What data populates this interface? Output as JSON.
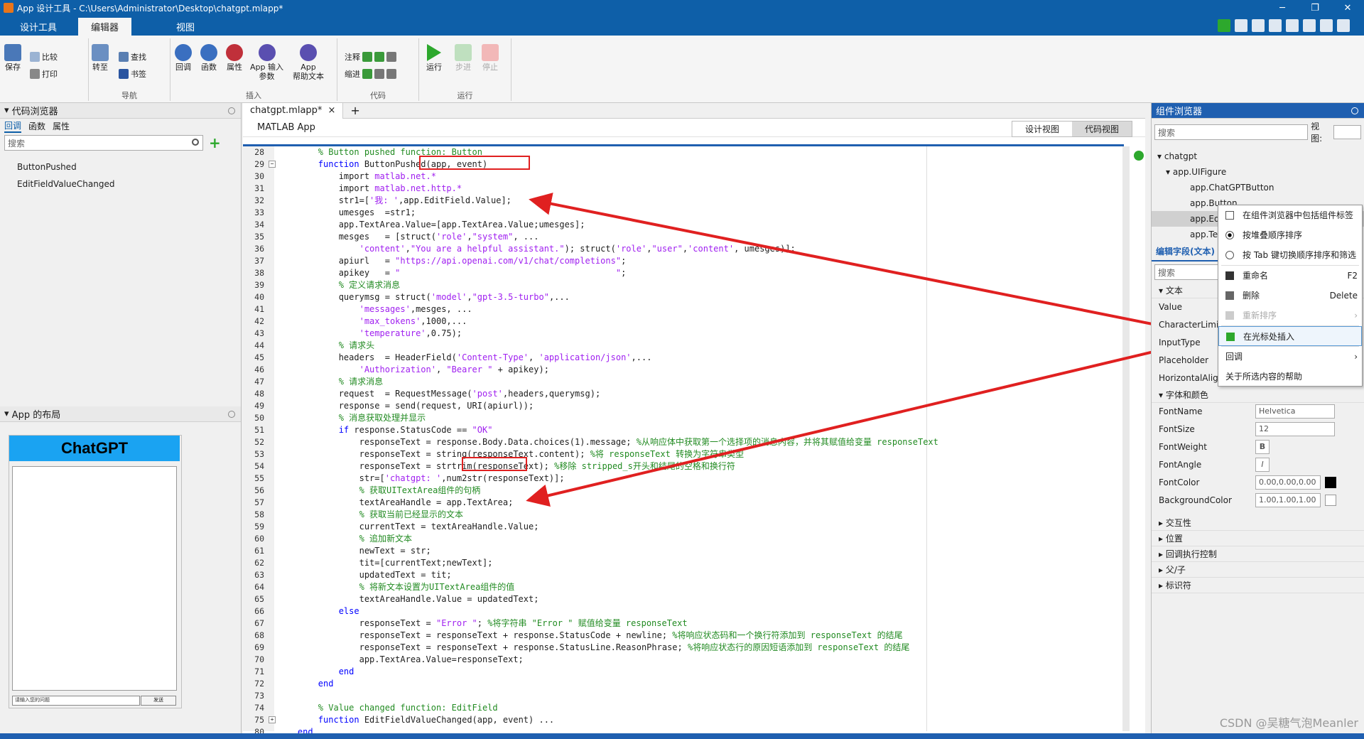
{
  "window": {
    "title": "App 设计工具 - C:\\Users\\Administrator\\Desktop\\chatgpt.mlapp*",
    "controls": [
      "─",
      "❐",
      "✕"
    ]
  },
  "ribbon_tabs": [
    "设计工具",
    "编辑器",
    "视图"
  ],
  "ribbon": {
    "file": {
      "save": "保存",
      "compare": "比较",
      "print": "打印"
    },
    "nav": {
      "goto": "转至",
      "find": "查找",
      "bookmark": "书签",
      "label": "导航"
    },
    "insert": {
      "callback": "回调",
      "function": "函数",
      "property": "属性",
      "app_input": "App 输入\n参数",
      "app_help": "App\n帮助文本",
      "label": "插入"
    },
    "code": {
      "comment": "注释",
      "indent": "缩进",
      "label": "代码"
    },
    "run": {
      "run": "运行",
      "step": "步进",
      "stop": "停止",
      "label": "运行"
    }
  },
  "code_browser": {
    "title": "代码浏览器",
    "tabs": [
      "回调",
      "函数",
      "属性"
    ],
    "search_placeholder": "搜索",
    "items": [
      "ButtonPushed",
      "EditFieldValueChanged"
    ]
  },
  "app_layout": {
    "title": "App 的布局",
    "chat_button": "ChatGPT",
    "input_placeholder": "请输入您的问题",
    "send": "发送"
  },
  "editor": {
    "file_tab": "chatgpt.mlapp*",
    "new_tab": "+",
    "header": "MATLAB App",
    "view_design": "设计视图",
    "view_code": "代码视图",
    "lines": [
      {
        "n": "28",
        "segs": [
          [
            "cm",
            "        % Button pushed function: Button"
          ]
        ]
      },
      {
        "n": "29",
        "fold": "−",
        "segs": [
          [
            "kw",
            "        function "
          ],
          [
            "",
            "ButtonPushed(app, event)"
          ]
        ]
      },
      {
        "n": "30",
        "segs": [
          [
            "",
            "            import "
          ],
          [
            "str",
            "matlab.net.*"
          ]
        ]
      },
      {
        "n": "31",
        "segs": [
          [
            "",
            "            import "
          ],
          [
            "str",
            "matlab.net.http.*"
          ]
        ]
      },
      {
        "n": "32",
        "segs": [
          [
            "",
            "            str1=["
          ],
          [
            "str",
            "'我: '"
          ],
          [
            "",
            ",app.EditField.Value];"
          ]
        ]
      },
      {
        "n": "33",
        "segs": [
          [
            "",
            "            umesges  =str1;"
          ]
        ]
      },
      {
        "n": "34",
        "segs": [
          [
            "",
            "            app.TextArea.Value=[app.TextArea.Value;umesges];"
          ]
        ]
      },
      {
        "n": "35",
        "segs": [
          [
            "",
            "            mesges   = [struct("
          ],
          [
            "str",
            "'role'"
          ],
          [
            "",
            ","
          ],
          [
            "str",
            "\"system\""
          ],
          [
            "",
            ", ..."
          ]
        ]
      },
      {
        "n": "36",
        "segs": [
          [
            "",
            "                "
          ],
          [
            "str",
            "'content'"
          ],
          [
            "",
            ","
          ],
          [
            "str",
            "\"You are a helpful assistant.\""
          ],
          [
            "",
            "); struct("
          ],
          [
            "str",
            "'role'"
          ],
          [
            "",
            ","
          ],
          [
            "str",
            "\"user\""
          ],
          [
            "",
            ","
          ],
          [
            "str",
            "'content'"
          ],
          [
            "",
            ", umesges)];"
          ]
        ]
      },
      {
        "n": "37",
        "segs": [
          [
            "",
            "            apiurl   = "
          ],
          [
            "str",
            "\"https://api.openai.com/v1/chat/completions\""
          ],
          [
            "",
            ";"
          ]
        ]
      },
      {
        "n": "38",
        "segs": [
          [
            "",
            "            apikey   = "
          ],
          [
            "str",
            "\"                                          \""
          ],
          [
            "",
            ";"
          ]
        ]
      },
      {
        "n": "39",
        "segs": [
          [
            "cm",
            "            % 定义请求消息"
          ]
        ]
      },
      {
        "n": "40",
        "segs": [
          [
            "",
            "            querymsg = struct("
          ],
          [
            "str",
            "'model'"
          ],
          [
            "",
            ","
          ],
          [
            "str",
            "\"gpt-3.5-turbo\""
          ],
          [
            "",
            ",..."
          ]
        ]
      },
      {
        "n": "41",
        "segs": [
          [
            "",
            "                "
          ],
          [
            "str",
            "'messages'"
          ],
          [
            "",
            ",mesges, ..."
          ]
        ]
      },
      {
        "n": "42",
        "segs": [
          [
            "",
            "                "
          ],
          [
            "str",
            "'max_tokens'"
          ],
          [
            "",
            ",1000,..."
          ]
        ]
      },
      {
        "n": "43",
        "segs": [
          [
            "",
            "                "
          ],
          [
            "str",
            "'temperature'"
          ],
          [
            "",
            ",0.75);"
          ]
        ]
      },
      {
        "n": "44",
        "segs": [
          [
            "cm",
            "            % 请求头"
          ]
        ]
      },
      {
        "n": "45",
        "segs": [
          [
            "",
            "            headers  = HeaderField("
          ],
          [
            "str",
            "'Content-Type'"
          ],
          [
            "",
            ", "
          ],
          [
            "str",
            "'application/json'"
          ],
          [
            "",
            ",..."
          ]
        ]
      },
      {
        "n": "46",
        "segs": [
          [
            "",
            "                "
          ],
          [
            "str",
            "'Authorization'"
          ],
          [
            "",
            ", "
          ],
          [
            "str",
            "\"Bearer \""
          ],
          [
            "",
            " + apikey);"
          ]
        ]
      },
      {
        "n": "47",
        "segs": [
          [
            "cm",
            "            % 请求消息"
          ]
        ]
      },
      {
        "n": "48",
        "segs": [
          [
            "",
            "            request  = RequestMessage("
          ],
          [
            "str",
            "'post'"
          ],
          [
            "",
            ",headers,querymsg);"
          ]
        ]
      },
      {
        "n": "49",
        "segs": [
          [
            "",
            "            response = send(request, URI(apiurl));"
          ]
        ]
      },
      {
        "n": "50",
        "segs": [
          [
            "cm",
            "            % 消息获取处理并显示"
          ]
        ]
      },
      {
        "n": "51",
        "segs": [
          [
            "kw",
            "            if "
          ],
          [
            "",
            "response.StatusCode == "
          ],
          [
            "str",
            "\"OK\""
          ]
        ]
      },
      {
        "n": "52",
        "segs": [
          [
            "",
            "                responseText = response.Body.Data.choices(1).message; "
          ],
          [
            "cm",
            "%从响应体中获取第一个选择项的消息内容，并将其赋值给变量 responseText"
          ]
        ]
      },
      {
        "n": "53",
        "segs": [
          [
            "",
            "                responseText = string(responseText.content); "
          ],
          [
            "cm",
            "%将 responseText 转换为字符串类型"
          ]
        ]
      },
      {
        "n": "54",
        "segs": [
          [
            "",
            "                responseText = strtrim(responseText); "
          ],
          [
            "cm",
            "%移除 stripped_s开头和结尾的空格和换行符"
          ]
        ]
      },
      {
        "n": "55",
        "segs": [
          [
            "",
            "                str=["
          ],
          [
            "str",
            "'chatgpt: '"
          ],
          [
            "",
            ",num2str(responseText)];"
          ]
        ]
      },
      {
        "n": "56",
        "segs": [
          [
            "cm",
            "                % 获取UITextArea组件的句柄"
          ]
        ]
      },
      {
        "n": "57",
        "segs": [
          [
            "",
            "                textAreaHandle = app.TextArea;"
          ]
        ]
      },
      {
        "n": "58",
        "segs": [
          [
            "cm",
            "                % 获取当前已经显示的文本"
          ]
        ]
      },
      {
        "n": "59",
        "segs": [
          [
            "",
            "                currentText = textAreaHandle.Value;"
          ]
        ]
      },
      {
        "n": "60",
        "segs": [
          [
            "cm",
            "                % 追加新文本"
          ]
        ]
      },
      {
        "n": "61",
        "segs": [
          [
            "",
            "                newText = str;"
          ]
        ]
      },
      {
        "n": "62",
        "segs": [
          [
            "",
            "                tit=[currentText;newText];"
          ]
        ]
      },
      {
        "n": "63",
        "segs": [
          [
            "",
            "                updatedText = tit;"
          ]
        ]
      },
      {
        "n": "64",
        "segs": [
          [
            "cm",
            "                % 将新文本设置为UITextArea组件的值"
          ]
        ]
      },
      {
        "n": "65",
        "segs": [
          [
            "",
            "                textAreaHandle.Value = updatedText;"
          ]
        ]
      },
      {
        "n": "66",
        "segs": [
          [
            "kw",
            "            else"
          ]
        ]
      },
      {
        "n": "67",
        "segs": [
          [
            "",
            "                responseText = "
          ],
          [
            "str",
            "\"Error \""
          ],
          [
            "",
            "; "
          ],
          [
            "cm",
            "%将字符串 \"Error \" 赋值给变量 responseText"
          ]
        ]
      },
      {
        "n": "68",
        "segs": [
          [
            "",
            "                responseText = responseText + response.StatusCode + newline; "
          ],
          [
            "cm",
            "%将响应状态码和一个换行符添加到 responseText 的结尾"
          ]
        ]
      },
      {
        "n": "69",
        "segs": [
          [
            "",
            "                responseText = responseText + response.StatusLine.ReasonPhrase; "
          ],
          [
            "cm",
            "%将响应状态行的原因短语添加到 responseText 的结尾"
          ]
        ]
      },
      {
        "n": "70",
        "segs": [
          [
            "",
            "                app.TextArea.Value=responseText;"
          ]
        ]
      },
      {
        "n": "71",
        "segs": [
          [
            "kw",
            "            end"
          ]
        ]
      },
      {
        "n": "72",
        "segs": [
          [
            "kw",
            "        end"
          ]
        ]
      },
      {
        "n": "73",
        "segs": [
          [
            "",
            ""
          ]
        ]
      },
      {
        "n": "74",
        "segs": [
          [
            "cm",
            "        % Value changed function: EditField"
          ]
        ]
      },
      {
        "n": "75",
        "fold": "+",
        "segs": [
          [
            "kw",
            "        function "
          ],
          [
            "",
            "EditFieldValueChanged(app, event)"
          ],
          [
            "",
            " ..."
          ]
        ]
      },
      {
        "n": "80",
        "segs": [
          [
            "kw",
            "    end"
          ]
        ]
      }
    ]
  },
  "component_browser": {
    "title": "组件浏览器",
    "search_placeholder": "搜索",
    "view_label": "视图:",
    "tree": [
      "chatgpt",
      "app.UIFigure",
      "app.ChatGPTButton",
      "app.Button",
      "app.Edi",
      "app.Tex"
    ],
    "inspector_title": "编辑字段(文本)",
    "inspector_search": "搜索",
    "sections": {
      "text": "文本",
      "font": "字体和颜色",
      "interactivity": "交互性",
      "position": "位置",
      "callback_ctrl": "回调执行控制",
      "parent_child": "父/子",
      "identifier": "标识符"
    },
    "text_props": [
      "Value",
      "CharacterLimits",
      "InputType",
      "Placeholder",
      "HorizontalAlignment"
    ],
    "font_props": {
      "FontName": "Helvetica",
      "FontSize": "12",
      "FontWeight": "B",
      "FontAngle": "I",
      "FontColor": "0.00,0.00,0.00",
      "BackgroundColor": "1.00,1.00,1.00"
    },
    "colors": {
      "font_color": "#000000",
      "bg_color": "#ffffff"
    }
  },
  "context_menu": {
    "items": [
      {
        "label": "在组件浏览器中包括组件标签",
        "type": "check",
        "checked": false
      },
      {
        "label": "按堆叠顺序排序",
        "type": "radio",
        "checked": true
      },
      {
        "label": "按 Tab 键切换顺序排序和筛选",
        "type": "radio",
        "checked": false
      },
      {
        "label": "重命名",
        "shortcut": "F2",
        "icon": "rename-icon"
      },
      {
        "label": "删除",
        "shortcut": "Delete",
        "icon": "trash-icon"
      },
      {
        "label": "重新排序",
        "disabled": true,
        "submenu": true
      },
      {
        "label": "在光标处插入",
        "highlighted": true,
        "icon": "insert-icon"
      },
      {
        "label": "回调",
        "submenu": true
      },
      {
        "label": "关于所选内容的帮助"
      }
    ]
  },
  "watermark": "CSDN @吴糖气泡Meanler"
}
